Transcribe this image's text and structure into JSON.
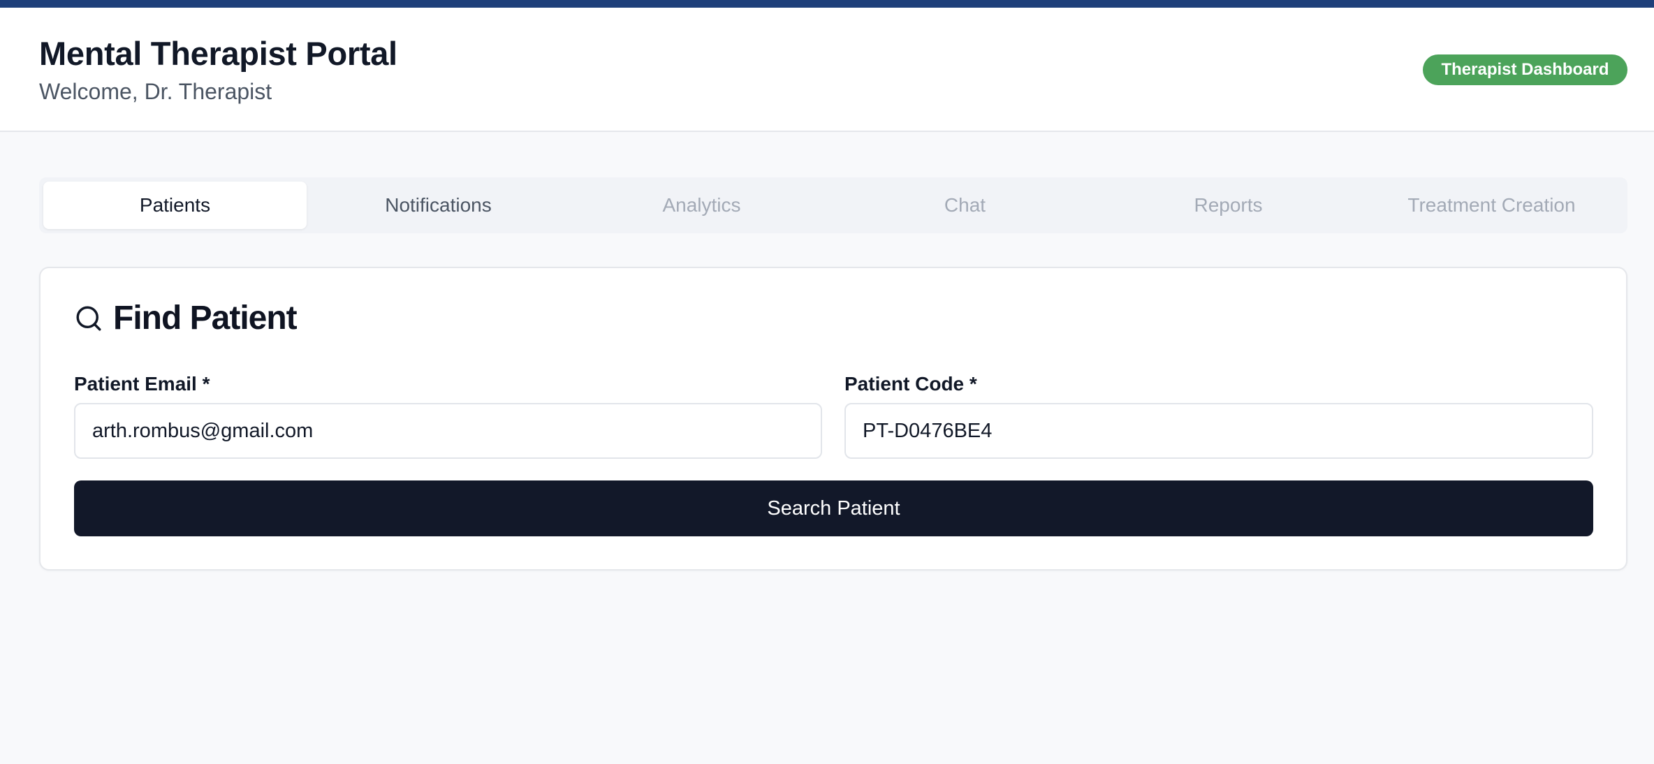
{
  "header": {
    "title": "Mental Therapist Portal",
    "subtitle": "Welcome, Dr. Therapist",
    "badge": "Therapist Dashboard"
  },
  "tabs": [
    {
      "label": "Patients",
      "state": "active"
    },
    {
      "label": "Notifications",
      "state": "enabled"
    },
    {
      "label": "Analytics",
      "state": "disabled"
    },
    {
      "label": "Chat",
      "state": "disabled"
    },
    {
      "label": "Reports",
      "state": "disabled"
    },
    {
      "label": "Treatment Creation",
      "state": "disabled"
    }
  ],
  "find_patient": {
    "icon": "search-icon",
    "title": "Find Patient",
    "email_label": "Patient Email *",
    "email_value": "arth.rombus@gmail.com",
    "code_label": "Patient Code *",
    "code_value": "PT-D0476BE4",
    "button_label": "Search Patient"
  },
  "colors": {
    "top_strip": "#1e3f7a",
    "badge": "#4ca35a",
    "primary_button": "#121829"
  }
}
